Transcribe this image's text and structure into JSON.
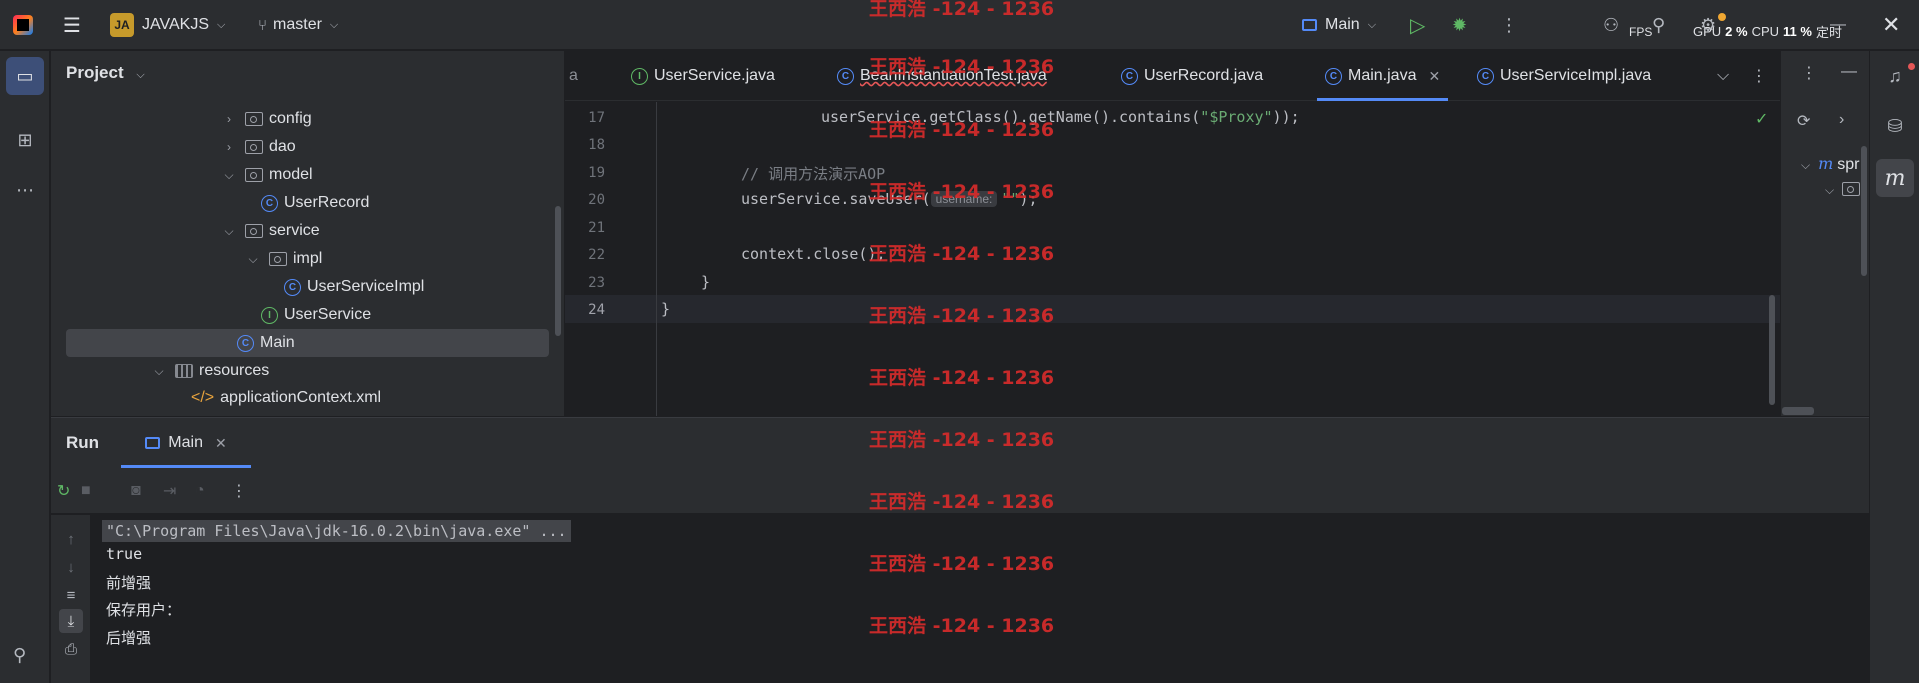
{
  "titlebar": {
    "project_badge": "JA",
    "project_name": "JAVAKJS",
    "branch": "master",
    "run_config": "Main",
    "fps_label": "FPS",
    "gpu_label": "GPU",
    "gpu_value": "2 %",
    "cpu_label": "CPU",
    "cpu_value": "11 %",
    "clock_label": "定时"
  },
  "project_panel": {
    "title": "Project",
    "items": [
      {
        "label": "config",
        "kind": "folder",
        "expanded": false
      },
      {
        "label": "dao",
        "kind": "folder",
        "expanded": false
      },
      {
        "label": "model",
        "kind": "folder",
        "expanded": true
      },
      {
        "label": "UserRecord",
        "kind": "class"
      },
      {
        "label": "service",
        "kind": "folder",
        "expanded": true
      },
      {
        "label": "impl",
        "kind": "folder",
        "expanded": true
      },
      {
        "label": "UserServiceImpl",
        "kind": "class"
      },
      {
        "label": "UserService",
        "kind": "interface"
      },
      {
        "label": "Main",
        "kind": "class",
        "selected": true
      },
      {
        "label": "resources",
        "kind": "resource-folder",
        "expanded": true
      },
      {
        "label": "applicationContext.xml",
        "kind": "xml"
      }
    ]
  },
  "editor": {
    "tabs": [
      {
        "label": "a"
      },
      {
        "label": "UserService.java",
        "icon": "interface"
      },
      {
        "label": "BeanInstantiationTest.java",
        "icon": "class",
        "error": true
      },
      {
        "label": "UserRecord.java",
        "icon": "class"
      },
      {
        "label": "Main.java",
        "icon": "class",
        "active": true,
        "close": "✕"
      },
      {
        "label": "UserServiceImpl.java",
        "icon": "class"
      }
    ],
    "line_numbers": [
      "17",
      "18",
      "19",
      "20",
      "21",
      "22",
      "23",
      "24"
    ],
    "code": {
      "l17_pre": "userService.getClass().getName().contains(",
      "l17_str": "\"$Proxy\"",
      "l17_post": "));",
      "l19_comment": "// 调用方法演示AOP",
      "l20_pre": "userService.saveUser(",
      "l20_hint": "username:",
      "l20_str": "\"\"",
      "l20_post": ");",
      "l22": "context.close();",
      "l23": "}",
      "l24": "}"
    }
  },
  "right_panel": {
    "tree_root": "spr"
  },
  "run_panel": {
    "title": "Run",
    "tab_label": "Main",
    "tab_close": "✕",
    "output": [
      "\"C:\\Program Files\\Java\\jdk-16.0.2\\bin\\java.exe\" ...",
      "true",
      "前增强",
      "保存用户：",
      "后增强"
    ]
  },
  "watermark": "王西浩 -124 - 1236",
  "colors": {
    "accent": "#548af7",
    "run_green": "#5fb865",
    "watermark_red": "#d62b2b",
    "background": "#1e1f22",
    "panel": "#2b2d30"
  }
}
